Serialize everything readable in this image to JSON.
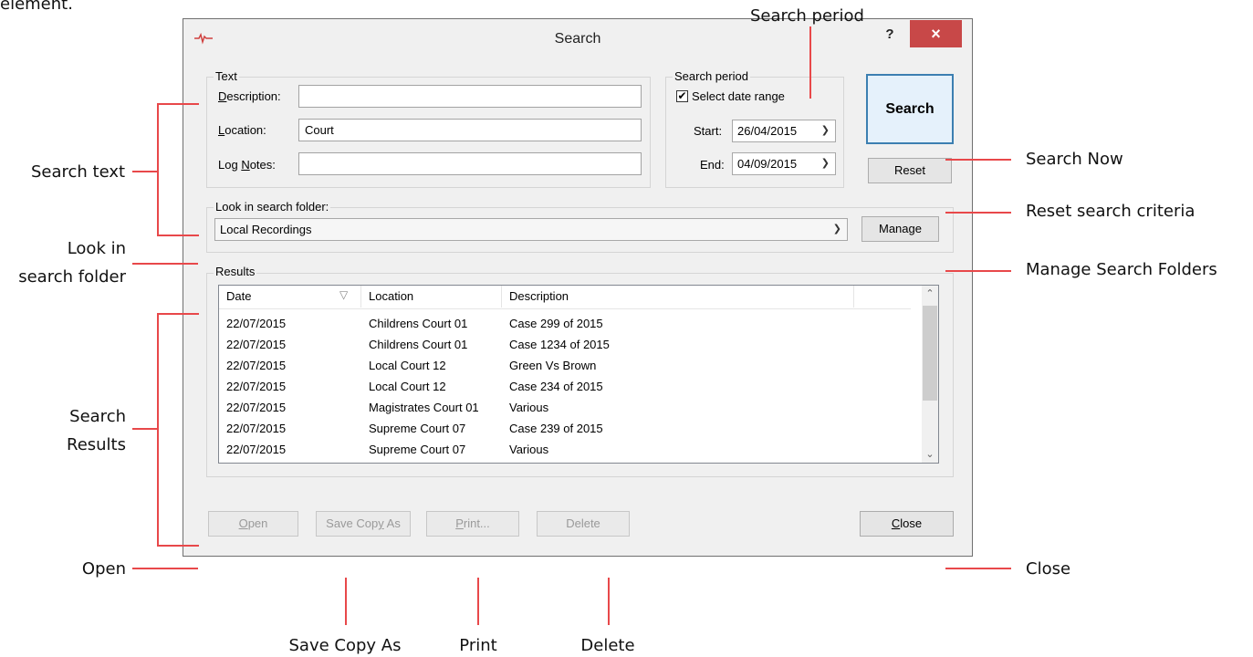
{
  "intro_text": "element.",
  "dialog": {
    "title": "Search",
    "help": "?",
    "close_glyph": "×"
  },
  "text_group": {
    "label": "Text",
    "description_label": "Description:",
    "description_value": "",
    "location_label": "Location:",
    "location_value": "Court",
    "lognotes_label": "Log Notes:",
    "lognotes_value": ""
  },
  "period_group": {
    "label": "Search period",
    "checkbox_label": "Select date range",
    "checkbox_checked": true,
    "start_label": "Start:",
    "start_value": "26/04/2015",
    "end_label": "End:",
    "end_value": "04/09/2015"
  },
  "buttons": {
    "search": "Search",
    "reset": "Reset",
    "manage": "Manage",
    "open": "Open",
    "save_copy_as": "Save Copy As",
    "print": "Print...",
    "delete": "Delete",
    "close": "Close"
  },
  "folder_group": {
    "label": "Look in search folder:",
    "selected": "Local Recordings"
  },
  "results": {
    "label": "Results",
    "columns": [
      "Date",
      "Location",
      "Description"
    ],
    "rows": [
      [
        "22/07/2015",
        "Childrens Court 01",
        "Case 299 of 2015"
      ],
      [
        "22/07/2015",
        "Childrens Court 01",
        "Case 1234 of 2015"
      ],
      [
        "22/07/2015",
        "Local Court 12",
        "Green Vs Brown"
      ],
      [
        "22/07/2015",
        "Local Court 12",
        "Case 234 of 2015"
      ],
      [
        "22/07/2015",
        "Magistrates Court 01",
        "Various"
      ],
      [
        "22/07/2015",
        "Supreme Court 07",
        "Case 239 of 2015"
      ],
      [
        "22/07/2015",
        "Supreme Court 07",
        "Various"
      ]
    ]
  },
  "annotations": {
    "search_period": "Search period",
    "search_text": "Search text",
    "search_now": "Search Now",
    "reset_criteria": "Reset search criteria",
    "look_in_1": "Look in",
    "look_in_2": "search folder",
    "manage_folders": "Manage Search Folders",
    "search_results_1": "Search",
    "search_results_2": "Results",
    "open": "Open",
    "close": "Close",
    "save_copy_as": "Save Copy As",
    "print": "Print",
    "delete": "Delete"
  },
  "colors": {
    "annotation_line": "#e8484a",
    "close_button": "#c84848",
    "default_button_border": "#3c7fb1"
  }
}
